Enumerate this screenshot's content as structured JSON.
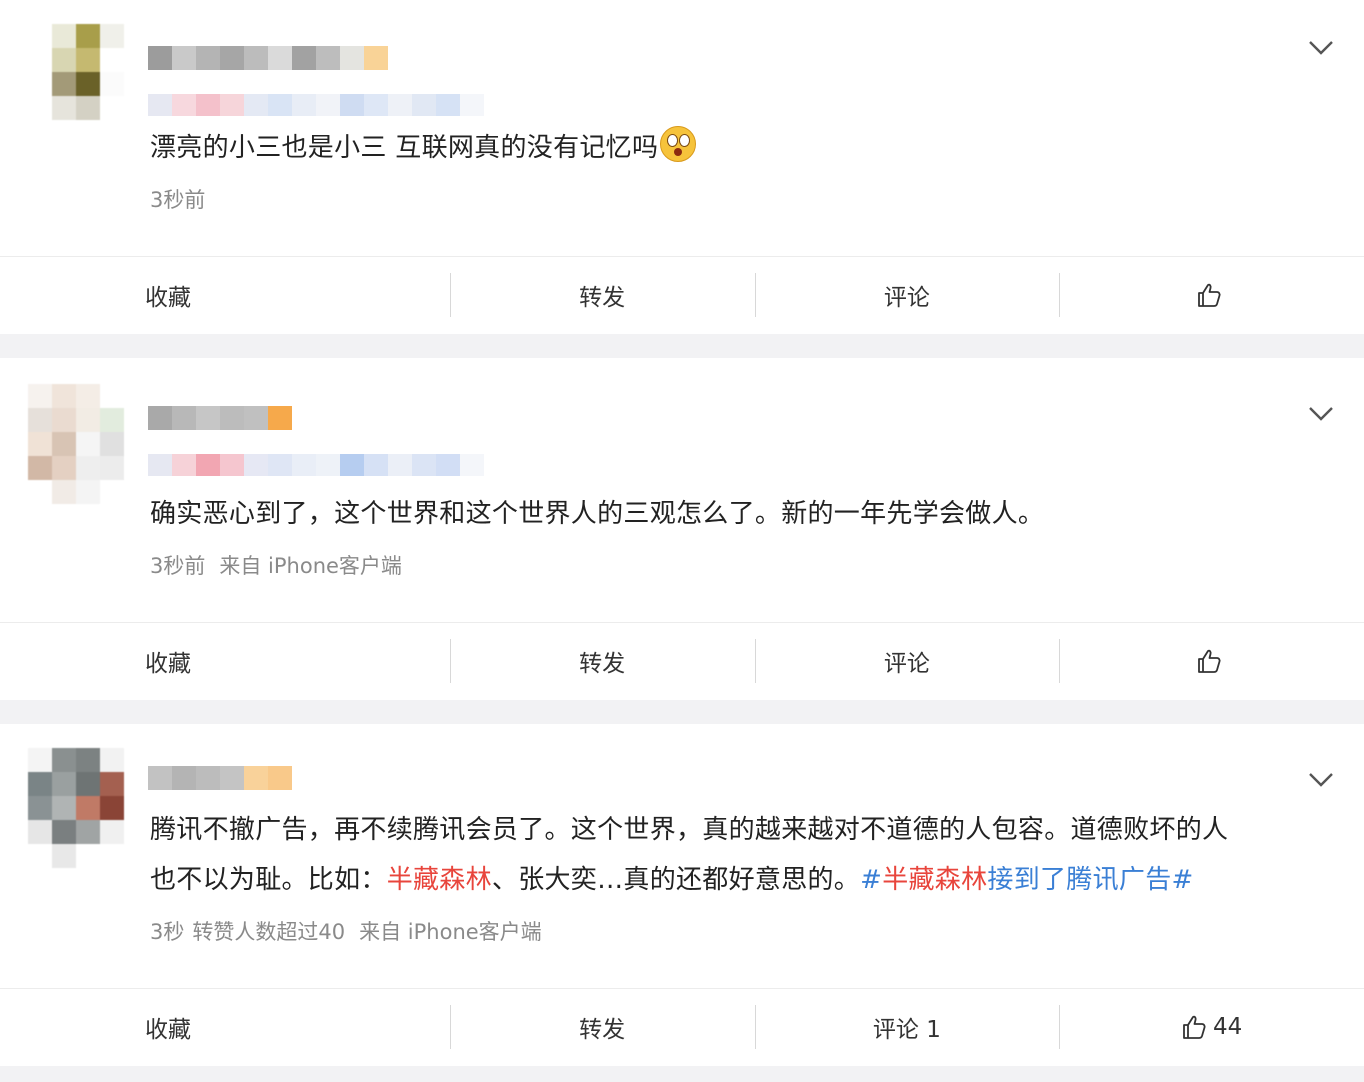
{
  "posts": [
    {
      "text": "漂亮的小三也是小三 互联网真的没有记忆吗",
      "time": "3秒前",
      "source": "",
      "actions": {
        "collect": "收藏",
        "repost": "转发",
        "comment": "评论",
        "like_count": ""
      }
    },
    {
      "text": "确实恶心到了，这个世界和这个世界人的三观怎么了。新的一年先学会做人。",
      "time": "3秒前",
      "source": "来自 iPhone客户端",
      "actions": {
        "collect": "收藏",
        "repost": "转发",
        "comment": "评论",
        "like_count": ""
      }
    },
    {
      "text_line1": "腾讯不撤广告，再不续腾讯会员了。这个世界，真的越来越对不道德的人包容。道德败坏的人",
      "text_line2_a": "也不以为耻。比如：",
      "text_line2_red1": "半藏森林",
      "text_line2_b": "、张大奕…真的还都好意思的。",
      "text_line2_hash_open": "#",
      "text_line2_red2": "半藏森林",
      "text_line2_blue": "接到了腾讯广告#",
      "time": "3秒",
      "extra": "转赞人数超过40",
      "source": "来自 iPhone客户端",
      "actions": {
        "collect": "收藏",
        "repost": "转发",
        "comment": "评论 1",
        "like_count": "44"
      }
    }
  ],
  "colors": {
    "link_red": "#e8453c",
    "link_blue": "#3a7fd5",
    "meta_gray": "#8a8a8a"
  },
  "icons": {
    "menu": "chevron-down-icon",
    "like": "thumbs-up-icon",
    "emoji": "surprised-emoji-icon"
  }
}
